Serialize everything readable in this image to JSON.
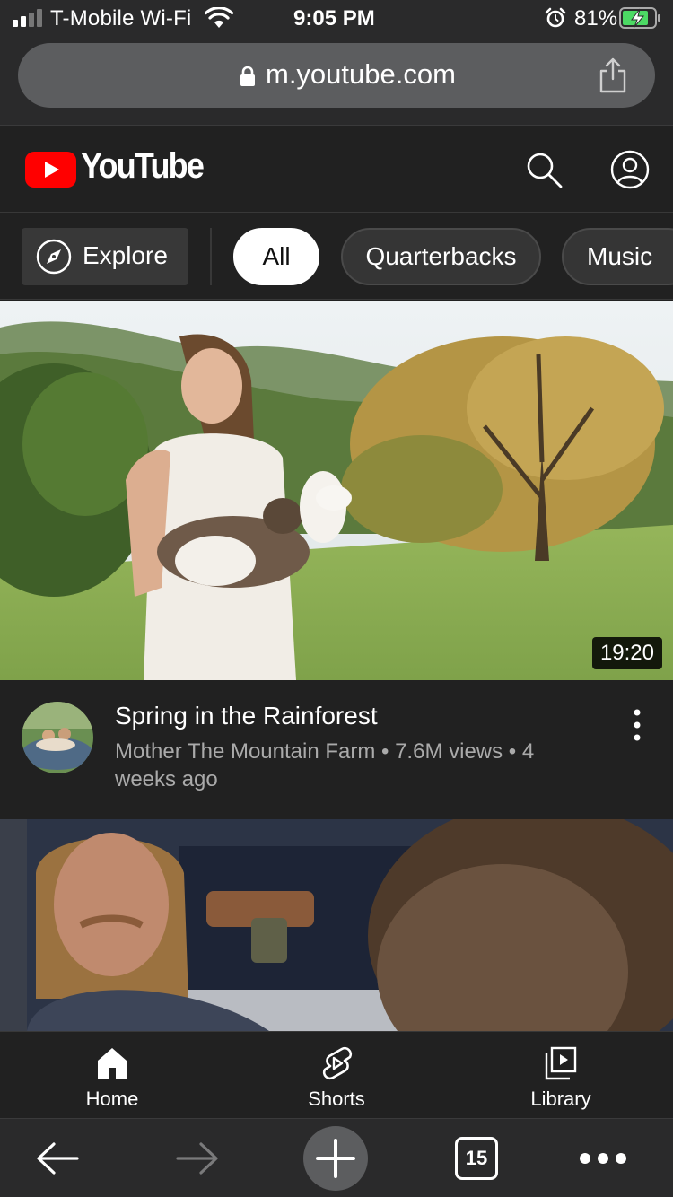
{
  "status_bar": {
    "carrier": "T-Mobile Wi-Fi",
    "time": "9:05 PM",
    "battery_percent": "81%",
    "icons": [
      "signal-icon",
      "wifi-icon",
      "alarm-icon",
      "battery-charging-icon"
    ]
  },
  "browser": {
    "url": "m.youtube.com",
    "icons": [
      "lock-icon",
      "share-icon"
    ]
  },
  "youtube_header": {
    "logo_text": "YouTube",
    "icons": [
      "youtube-logo-icon",
      "search-icon",
      "account-icon"
    ]
  },
  "chips": {
    "explore_label": "Explore",
    "items": [
      {
        "label": "All",
        "selected": true
      },
      {
        "label": "Quarterbacks",
        "selected": false
      },
      {
        "label": "Music",
        "selected": false
      }
    ]
  },
  "videos": [
    {
      "duration": "19:20",
      "title": "Spring in the Rainforest",
      "subtitle": "Mother The Mountain Farm • 7.6M views • 4 weeks ago"
    }
  ],
  "bottom_nav": {
    "items": [
      {
        "label": "Home",
        "icon": "home-icon"
      },
      {
        "label": "Shorts",
        "icon": "shorts-icon"
      },
      {
        "label": "Library",
        "icon": "library-icon"
      }
    ]
  },
  "browser_toolbar": {
    "tab_count": "15",
    "icons": [
      "back-arrow-icon",
      "forward-arrow-icon",
      "new-tab-plus-icon",
      "tabs-icon",
      "more-icon"
    ]
  },
  "colors": {
    "youtube_red": "#ff0000",
    "background": "#212121",
    "chip_selected": "#ffffff",
    "secondary_text": "#aaaaaa"
  }
}
